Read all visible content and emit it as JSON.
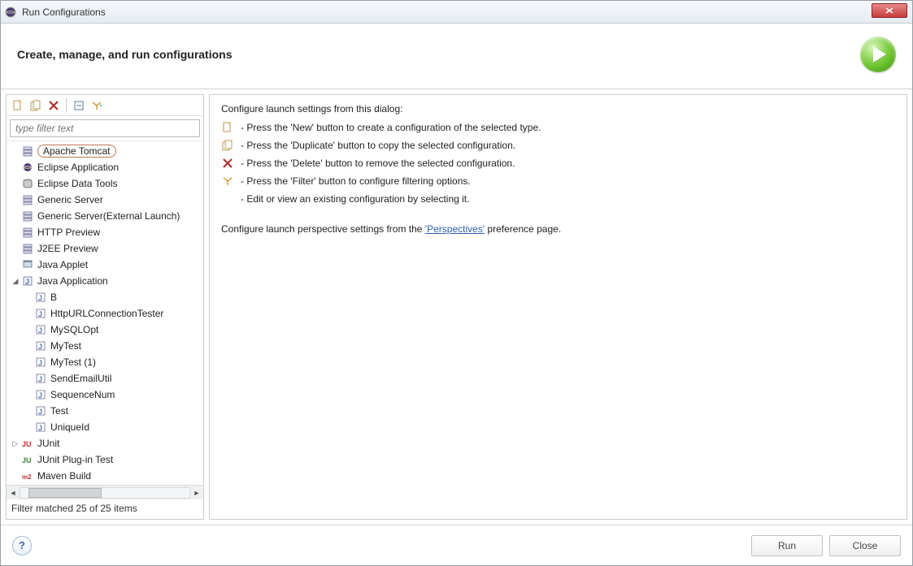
{
  "title": "Run Configurations",
  "header": "Create, manage, and run configurations",
  "filter_placeholder": "type filter text",
  "tree": [
    {
      "label": "Apache Tomcat",
      "icon": "server",
      "selected": true,
      "expand": ""
    },
    {
      "label": "Eclipse Application",
      "icon": "eclipse",
      "expand": ""
    },
    {
      "label": "Eclipse Data Tools",
      "icon": "db",
      "expand": ""
    },
    {
      "label": "Generic Server",
      "icon": "server",
      "expand": ""
    },
    {
      "label": "Generic Server(External Launch)",
      "icon": "server",
      "expand": ""
    },
    {
      "label": "HTTP Preview",
      "icon": "server",
      "expand": ""
    },
    {
      "label": "J2EE Preview",
      "icon": "server",
      "expand": ""
    },
    {
      "label": "Java Applet",
      "icon": "applet",
      "expand": ""
    },
    {
      "label": "Java Application",
      "icon": "java",
      "expand": "open"
    },
    {
      "label": "B",
      "icon": "j",
      "child": true
    },
    {
      "label": "HttpURLConnectionTester",
      "icon": "j",
      "child": true
    },
    {
      "label": "MySQLOpt",
      "icon": "j",
      "child": true
    },
    {
      "label": "MyTest",
      "icon": "j",
      "child": true
    },
    {
      "label": "MyTest (1)",
      "icon": "j",
      "child": true
    },
    {
      "label": "SendEmailUtil",
      "icon": "j",
      "child": true
    },
    {
      "label": "SequenceNum",
      "icon": "j",
      "child": true
    },
    {
      "label": "Test",
      "icon": "j",
      "child": true
    },
    {
      "label": "UniqueId",
      "icon": "j",
      "child": true
    },
    {
      "label": "JUnit",
      "icon": "junit",
      "expand": "closed"
    },
    {
      "label": "JUnit Plug-in Test",
      "icon": "junitp",
      "expand": ""
    },
    {
      "label": "Maven Build",
      "icon": "m2",
      "expand": ""
    }
  ],
  "status": "Filter matched 25 of 25 items",
  "intro": "Configure launch settings from this dialog:",
  "instructions": [
    {
      "icon": "new",
      "text": "- Press the 'New' button to create a configuration of the selected type."
    },
    {
      "icon": "dup",
      "text": "- Press the 'Duplicate' button to copy the selected configuration."
    },
    {
      "icon": "del",
      "text": "- Press the 'Delete' button to remove the selected configuration."
    },
    {
      "icon": "filt",
      "text": "- Press the 'Filter' button to configure filtering options."
    },
    {
      "icon": "",
      "text": "- Edit or view an existing configuration by selecting it."
    }
  ],
  "perspectives_pre": "Configure launch perspective settings from the ",
  "perspectives_link": "'Perspectives'",
  "perspectives_post": " preference page.",
  "buttons": {
    "run": "Run",
    "close": "Close"
  }
}
